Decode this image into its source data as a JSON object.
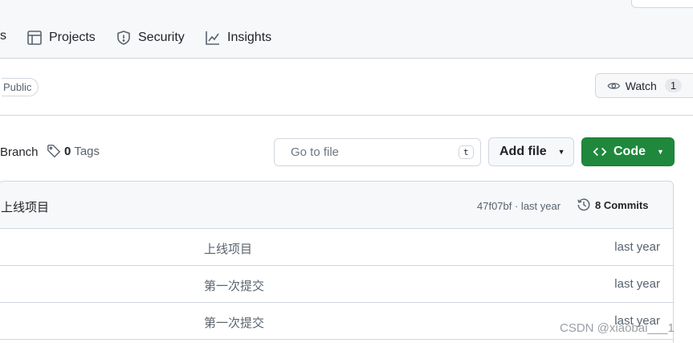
{
  "nav": {
    "partial_left": "s",
    "items": [
      {
        "label": "Projects",
        "icon": "table-icon"
      },
      {
        "label": "Security",
        "icon": "shield-icon"
      },
      {
        "label": "Insights",
        "icon": "graph-icon"
      }
    ]
  },
  "repo": {
    "visibility": "Public",
    "watch_label": "Watch",
    "watch_count": "1"
  },
  "toolbar": {
    "branch_partial": "Branch",
    "tags_count": "0",
    "tags_label": "Tags",
    "search_placeholder": "Go to file",
    "search_shortcut": "t",
    "add_file_label": "Add file",
    "code_label": "Code"
  },
  "latest_commit": {
    "message": "上线项目",
    "meta": "47f07bf · last year",
    "commits_label": "8 Commits"
  },
  "files": [
    {
      "message": "上线项目",
      "time": "last year"
    },
    {
      "message": "第一次提交",
      "time": "last year"
    },
    {
      "message": "第一次提交",
      "time": "last year"
    }
  ],
  "watermark": "CSDN @xiaobai___1",
  "colors": {
    "accent_green": "#1f883d",
    "border": "#d0d7de",
    "muted": "#59636e"
  }
}
